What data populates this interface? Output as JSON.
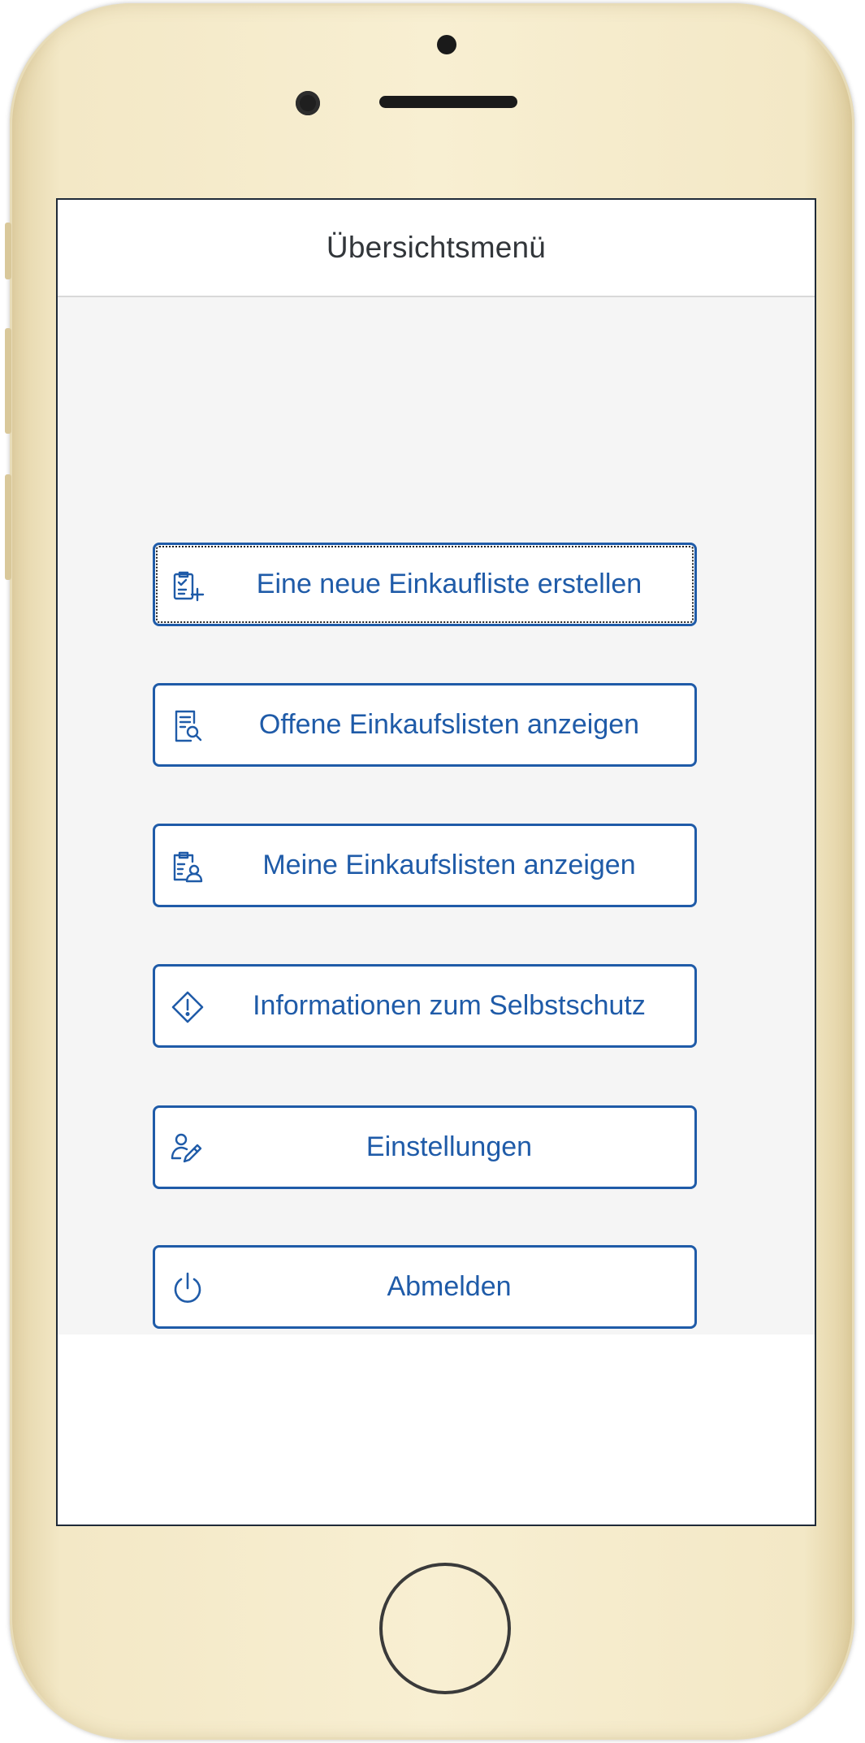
{
  "header": {
    "title": "Übersichtsmenü"
  },
  "menu": {
    "items": [
      {
        "label": "Eine neue Einkaufliste erstellen",
        "icon": "clipboard-add-icon"
      },
      {
        "label": "Offene Einkaufslisten anzeigen",
        "icon": "document-search-icon"
      },
      {
        "label": "Meine Einkaufslisten anzeigen",
        "icon": "clipboard-user-icon"
      },
      {
        "label": "Informationen zum Selbstschutz",
        "icon": "warning-diamond-icon"
      },
      {
        "label": "Einstellungen",
        "icon": "user-edit-icon"
      },
      {
        "label": "Abmelden",
        "icon": "power-icon"
      }
    ]
  },
  "colors": {
    "accent": "#1f5ba8",
    "title_text": "#32363a",
    "content_bg": "#f5f5f5",
    "phone_body": "#f3e8c6"
  }
}
